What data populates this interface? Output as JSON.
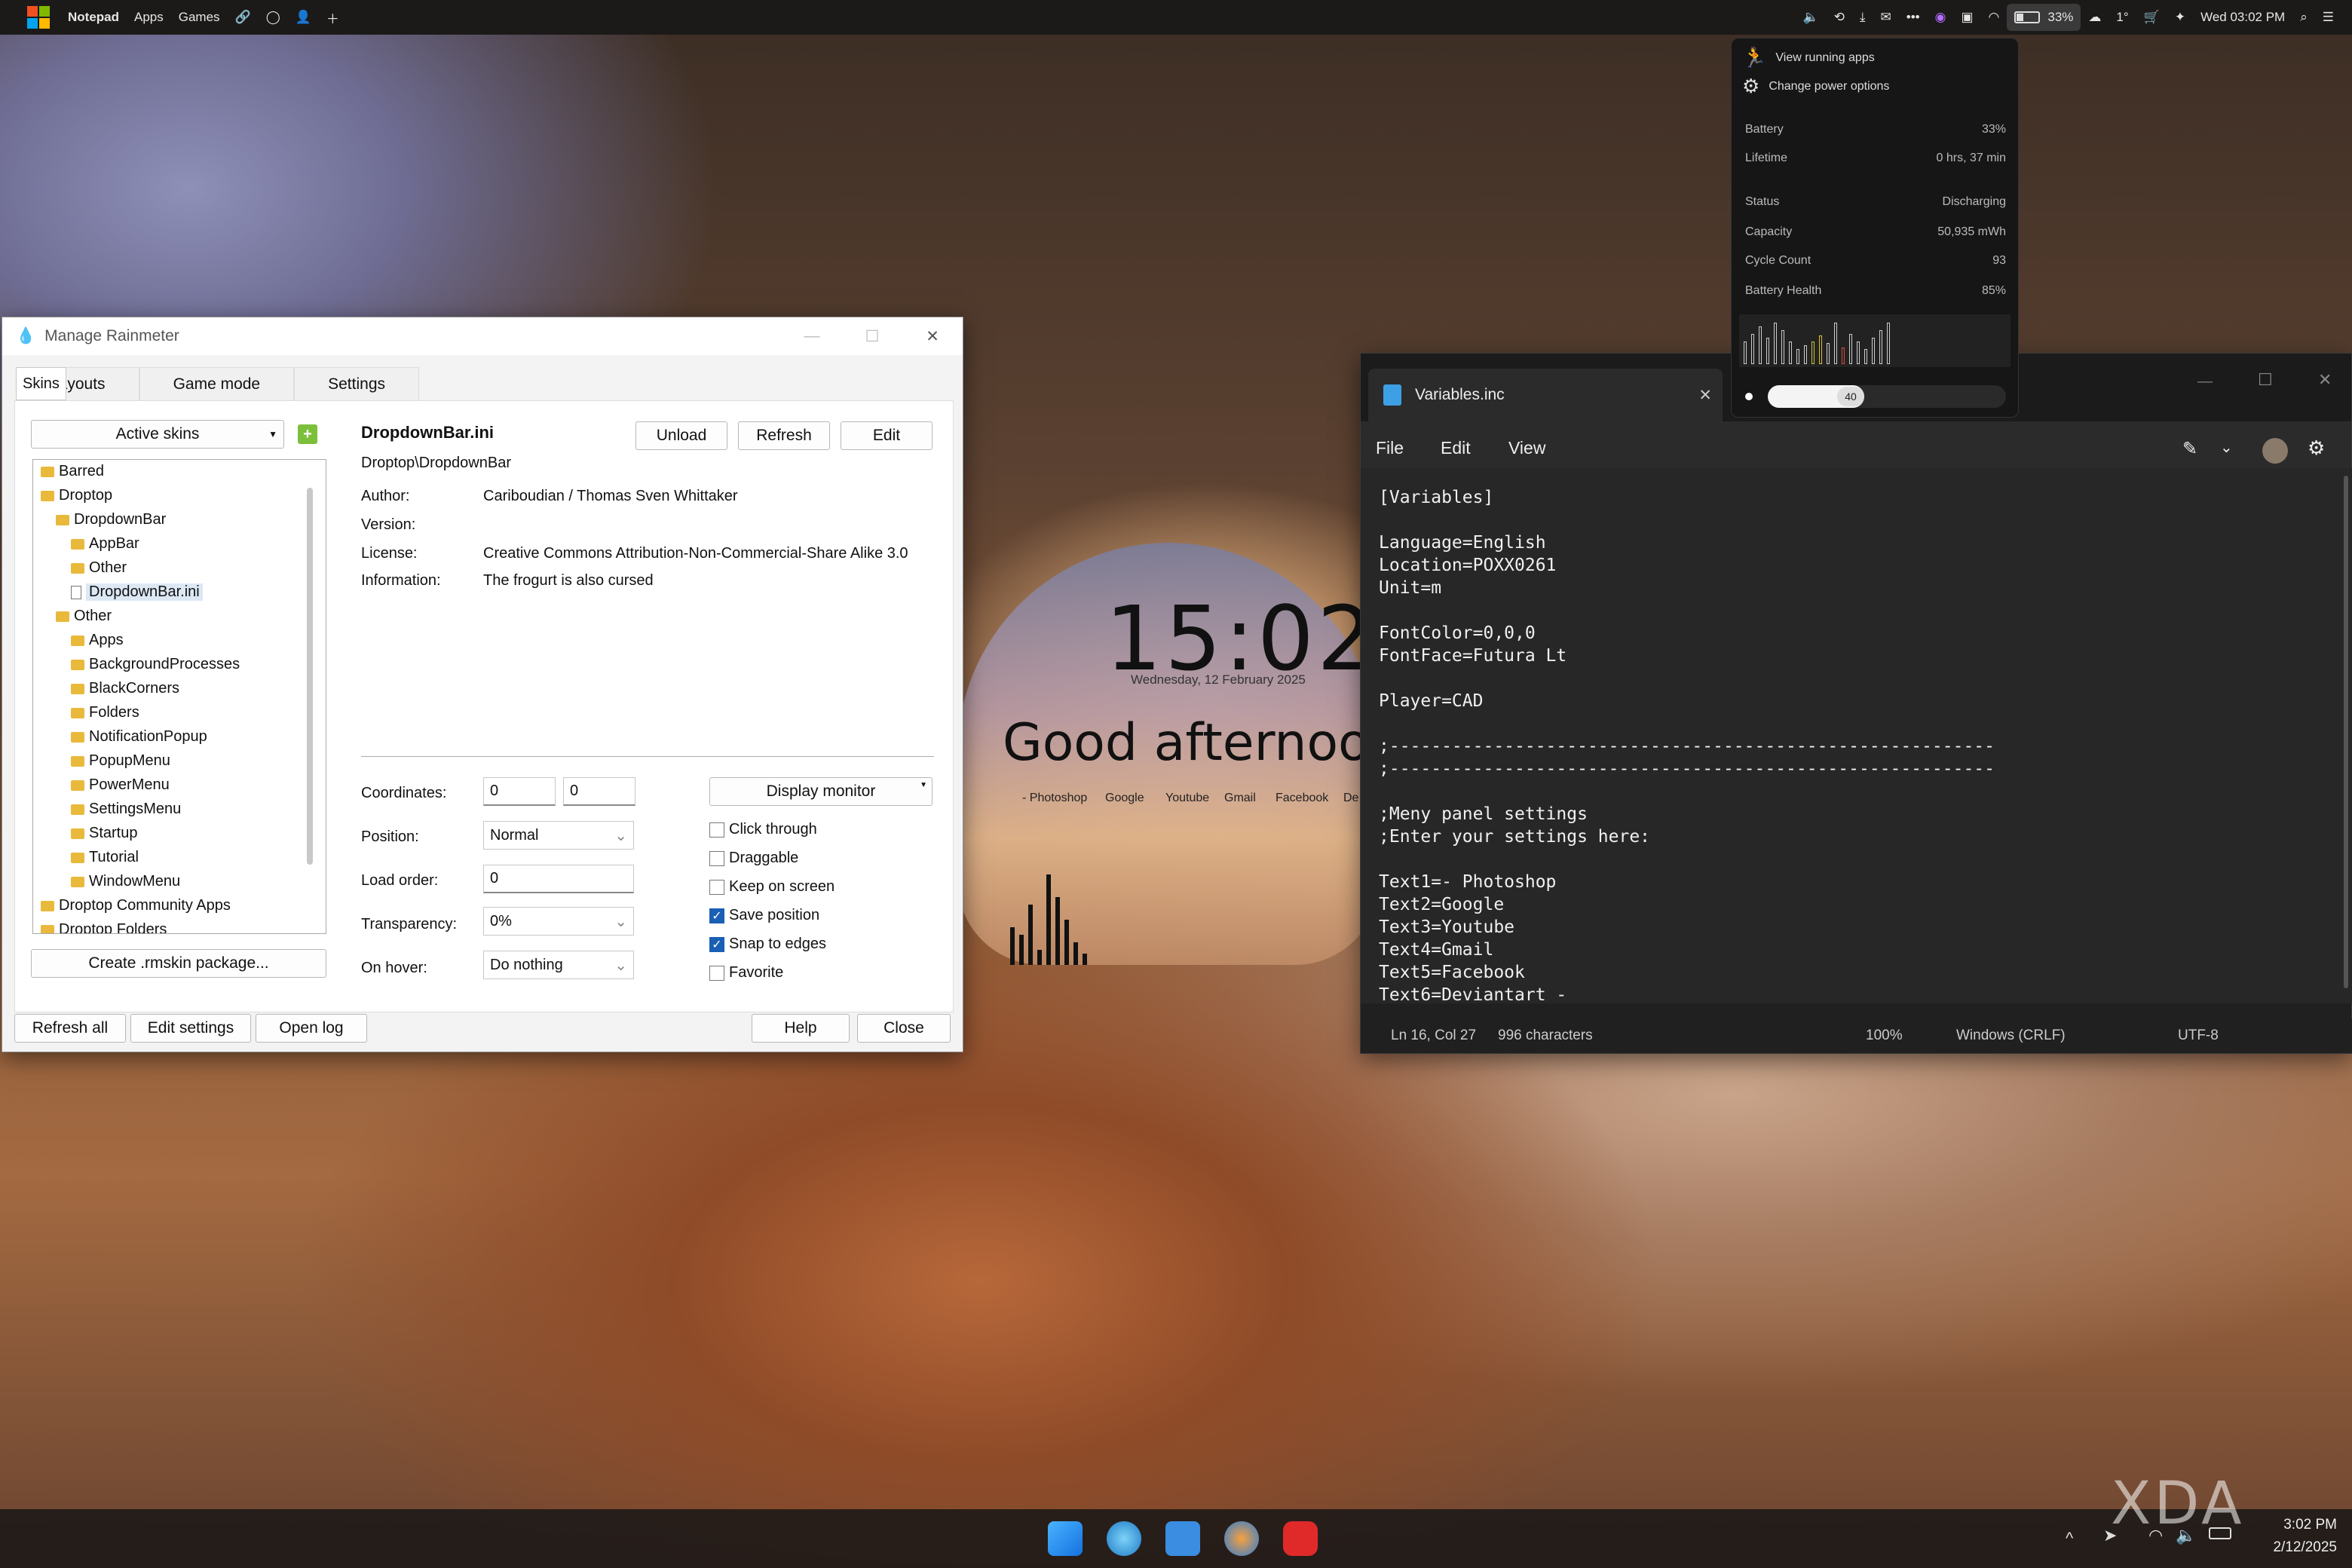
{
  "topbar": {
    "app": "Notepad",
    "menus": [
      "Apps",
      "Games"
    ],
    "battery_pct": "33%",
    "weather": "1°",
    "datetime": "Wed 03:02 PM"
  },
  "battery_popup": {
    "actions": [
      "View running apps",
      "Change power options"
    ],
    "rows": [
      [
        "Battery",
        "33%"
      ],
      [
        "Lifetime",
        "0 hrs, 37 min"
      ],
      [
        "Status",
        "Discharging"
      ],
      [
        "Capacity",
        "50,935 mWh"
      ],
      [
        "Cycle Count",
        "93"
      ],
      [
        "Battery Health",
        "85%"
      ]
    ],
    "slider_value": "40"
  },
  "rainmeter": {
    "title": "Manage Rainmeter",
    "tabs": [
      "Skins",
      "Layouts",
      "Game mode",
      "Settings"
    ],
    "active_skins": "Active skins",
    "skin_file": "DropdownBar.ini",
    "skin_path": "Droptop\\DropdownBar",
    "buttons": {
      "unload": "Unload",
      "refresh": "Refresh",
      "edit": "Edit",
      "create_pkg": "Create .rmskin package...",
      "refresh_all": "Refresh all",
      "edit_settings": "Edit settings",
      "open_log": "Open log",
      "help": "Help",
      "close": "Close"
    },
    "info": [
      [
        "Author:",
        "Cariboudian / Thomas Sven Whittaker"
      ],
      [
        "Version:",
        ""
      ],
      [
        "License:",
        "Creative Commons Attribution-Non-Commercial-Share Alike 3.0"
      ],
      [
        "Information:",
        "The frogurt is also cursed"
      ]
    ],
    "coords_label": "Coordinates:",
    "coord_x": "0",
    "coord_y": "0",
    "display_monitor": "Display monitor",
    "position_label": "Position:",
    "position": "Normal",
    "load_label": "Load order:",
    "load_order": "0",
    "trans_label": "Transparency:",
    "transparency": "0%",
    "hover_label": "On hover:",
    "hover": "Do nothing",
    "checks": [
      [
        "Click through",
        false
      ],
      [
        "Draggable",
        false
      ],
      [
        "Keep on screen",
        false
      ],
      [
        "Save position",
        true
      ],
      [
        "Snap to edges",
        true
      ],
      [
        "Favorite",
        false
      ]
    ],
    "tree": [
      "Barred",
      "Droptop",
      "DropdownBar",
      "AppBar",
      "Other",
      "DropdownBar.ini",
      "Other",
      "Apps",
      "BackgroundProcesses",
      "BlackCorners",
      "Folders",
      "NotificationPopup",
      "PopupMenu",
      "PowerMenu",
      "SettingsMenu",
      "Startup",
      "Tutorial",
      "WindowMenu",
      "Droptop Community Apps",
      "Droptop Folders"
    ]
  },
  "notepad": {
    "tab": "Variables.inc",
    "menus": [
      "File",
      "Edit",
      "View"
    ],
    "content": "[Variables]\n\nLanguage=English\nLocation=POXX0261\nUnit=m\n\nFontColor=0,0,0\nFontFace=Futura Lt\n\nPlayer=CAD\n\n;----------------------------------------------------------\n;----------------------------------------------------------\n\n;Meny panel settings\n;Enter your settings here:\n\nText1=- Photoshop\nText2=Google\nText3=Youtube\nText4=Gmail\nText5=Facebook\nText6=Deviantart -",
    "status": {
      "pos": "Ln 16, Col 27",
      "chars": "996 characters",
      "zoom": "100%",
      "eol": "Windows (CRLF)",
      "enc": "UTF-8"
    }
  },
  "desktop": {
    "time": "15:02",
    "date": "Wednesday, 12 February 2025",
    "greeting": "Good afternoon,",
    "links": [
      "- Photoshop",
      "Google",
      "Youtube",
      "Gmail",
      "Facebook",
      "De"
    ]
  },
  "taskbar": {
    "time": "3:02 PM",
    "date": "2/12/2025"
  },
  "watermark": "XDA"
}
